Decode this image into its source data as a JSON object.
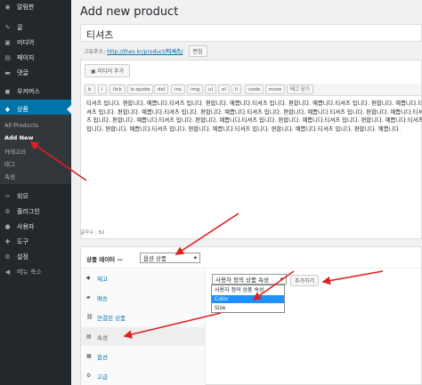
{
  "sidebar": {
    "items": [
      {
        "label": "알림판",
        "icon": "dashboard-icon",
        "glyph": "◉"
      },
      {
        "label": "글",
        "icon": "pin-icon",
        "glyph": "✎"
      },
      {
        "label": "미디어",
        "icon": "media-icon",
        "glyph": "▣"
      },
      {
        "label": "페이지",
        "icon": "page-icon",
        "glyph": "▤"
      },
      {
        "label": "댓글",
        "icon": "comment-icon",
        "glyph": "▬"
      },
      {
        "label": "우커머스",
        "icon": "woocommerce-icon",
        "glyph": "◼"
      },
      {
        "label": "상품",
        "icon": "products-icon",
        "glyph": "◆"
      }
    ],
    "submenu": [
      "All Products",
      "Add New",
      "카테고리",
      "태그",
      "속성"
    ],
    "lower": [
      {
        "label": "외모",
        "icon": "appearance-icon",
        "glyph": "✑"
      },
      {
        "label": "플러그인",
        "icon": "plugin-icon",
        "glyph": "⚙"
      },
      {
        "label": "사용자",
        "icon": "users-icon",
        "glyph": "●"
      },
      {
        "label": "도구",
        "icon": "tools-icon",
        "glyph": "✚"
      },
      {
        "label": "설정",
        "icon": "settings-icon",
        "glyph": "⚙"
      },
      {
        "label": "메뉴 축소",
        "icon": "collapse-icon",
        "glyph": "◀"
      }
    ]
  },
  "page_title": "Add new product",
  "post_title": "티셔츠",
  "permalink": {
    "label": "고유주소:",
    "url_base": "http://thex.kr/product/",
    "slug": "티셔츠/",
    "edit_label": "편집"
  },
  "editor": {
    "media_button": "미디어 추가",
    "quicktags": [
      "b",
      "i",
      "link",
      "b-quote",
      "del",
      "ins",
      "img",
      "ul",
      "ol",
      "li",
      "code",
      "more",
      "태그 닫기"
    ],
    "body": "티셔츠 입니다. 편합니다. 예쁩니다.티셔츠 입니다. 편합니다. 예쁩니다.티셔츠 입니다. 편합니다. 예쁩니다.티셔츠 입니다. 편합니다. 예쁩니다.티셔츠 입니다. 편합니다. 예쁩니다.티셔츠 입니다. 편합니다. 예쁩니다.티셔츠 입니다. 편합니다. 예쁩니다.티셔츠 입니다. 편합니다. 예쁩니다.티셔츠 입니다. 편합니다. 예쁩니다.티셔츠 입니다. 편합니다. 예쁩니다.티셔츠 입니다. 편합니다. 예쁩니다.티셔츠 입니다. 편합니다. 예쁩니다.티셔츠 입니다. 편합니다. 예쁩니다.티셔츠 입니다. 편합니다. 예쁩니다.티셔츠 입니다. 편합니다. 예쁩니다.티셔츠 입니다. 편합니다. 예쁩니다.",
    "word_count": "글자수 : 82"
  },
  "product_data": {
    "label": "상품 데이터 —",
    "type_select": "옵션 상품",
    "tabs": [
      {
        "label": "재고",
        "icon": "inventory-icon",
        "glyph": "◆"
      },
      {
        "label": "배송",
        "icon": "shipping-icon",
        "glyph": "▰"
      },
      {
        "label": "연결된 상품",
        "icon": "link-icon",
        "glyph": "⛓"
      },
      {
        "label": "속성",
        "icon": "attributes-icon",
        "glyph": "▤"
      },
      {
        "label": "옵션",
        "icon": "variations-icon",
        "glyph": "▦"
      },
      {
        "label": "고급",
        "icon": "advanced-icon",
        "glyph": "⚙"
      }
    ],
    "attribute_select": "사용자 정의 상품 속성",
    "add_button": "추가하기",
    "dropdown_options": [
      "사용자 정의 상품 속성",
      "Color",
      "Size"
    ]
  },
  "accent_color": "#0073aa",
  "annotation_color": "#e02020"
}
